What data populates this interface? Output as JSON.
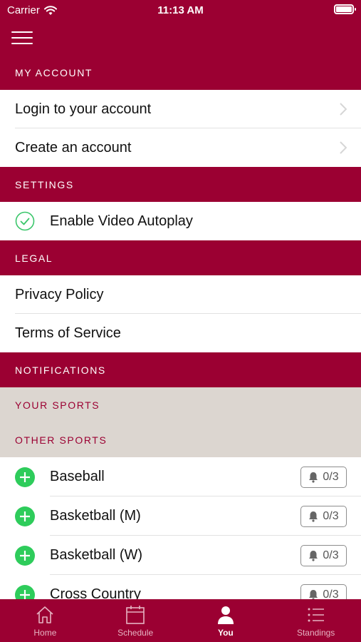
{
  "status_bar": {
    "carrier": "Carrier",
    "time": "11:13 AM"
  },
  "colors": {
    "primary": "#9b0032",
    "subheader_bg": "#dcd6d0",
    "add_green": "#2ecc5b",
    "check_green": "#3bc66b"
  },
  "sections": {
    "my_account": {
      "title": "MY ACCOUNT",
      "items": [
        {
          "label": "Login to your account",
          "icon": "chevron-right-icon"
        },
        {
          "label": "Create an account",
          "icon": "chevron-right-icon"
        }
      ]
    },
    "settings": {
      "title": "SETTINGS",
      "items": [
        {
          "label": "Enable Video Autoplay",
          "icon": "check-circle-icon",
          "checked": true
        }
      ]
    },
    "legal": {
      "title": "LEGAL",
      "items": [
        {
          "label": "Privacy Policy"
        },
        {
          "label": "Terms of Service"
        }
      ]
    },
    "notifications": {
      "title": "NOTIFICATIONS",
      "your_sports": "YOUR SPORTS",
      "other_sports": "OTHER SPORTS",
      "sports": [
        {
          "name": "Baseball",
          "count": "0/3"
        },
        {
          "name": "Basketball (M)",
          "count": "0/3"
        },
        {
          "name": "Basketball (W)",
          "count": "0/3"
        },
        {
          "name": "Cross Country",
          "count": "0/3"
        }
      ]
    }
  },
  "tabs": [
    {
      "label": "Home",
      "icon": "home-icon",
      "active": false
    },
    {
      "label": "Schedule",
      "icon": "calendar-icon",
      "active": false
    },
    {
      "label": "You",
      "icon": "person-icon",
      "active": true
    },
    {
      "label": "Standings",
      "icon": "list-icon",
      "active": false
    }
  ]
}
